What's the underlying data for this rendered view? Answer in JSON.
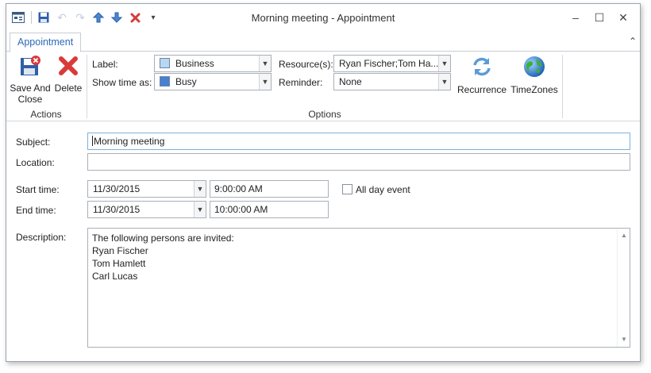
{
  "window": {
    "title": "Morning meeting - Appointment",
    "controls": {
      "minimize": "–",
      "maximize": "☐",
      "close": "✕"
    }
  },
  "quick_access": {
    "icons": [
      "app-icon",
      "save-icon",
      "undo-icon",
      "redo-icon",
      "previous-icon",
      "next-icon",
      "delete-icon",
      "customize-icon"
    ]
  },
  "tabs": [
    {
      "label": "Appointment",
      "active": true
    }
  ],
  "ribbon": {
    "actions_group": {
      "label": "Actions",
      "save_and_close": "Save And Close",
      "delete": "Delete"
    },
    "options_group": {
      "label": "Options",
      "label_field": {
        "caption": "Label:",
        "value": "Business",
        "swatch": "#b7d7f2"
      },
      "show_time_as": {
        "caption": "Show time as:",
        "value": "Busy",
        "swatch": "#4a7fd1"
      },
      "resources": {
        "caption": "Resource(s):",
        "value": "Ryan Fischer;Tom Ha..."
      },
      "reminder": {
        "caption": "Reminder:",
        "value": "None"
      },
      "recurrence": "Recurrence",
      "timezones": "TimeZones"
    }
  },
  "form": {
    "subject": {
      "label": "Subject:",
      "value": "Morning meeting"
    },
    "location": {
      "label": "Location:",
      "value": ""
    },
    "start_time": {
      "label": "Start time:",
      "date": "11/30/2015",
      "time": "9:00:00 AM"
    },
    "end_time": {
      "label": "End time:",
      "date": "11/30/2015",
      "time": "10:00:00 AM"
    },
    "all_day": {
      "label": "All day event",
      "checked": false
    },
    "description": {
      "label": "Description:",
      "lines": [
        "The following persons are invited:",
        "Ryan Fischer",
        "Tom Hamlett",
        "Carl Lucas"
      ]
    }
  },
  "colors": {
    "accent": "#2b6bb5",
    "delete_red": "#d93a3a",
    "save_blue": "#2f5fa8"
  }
}
